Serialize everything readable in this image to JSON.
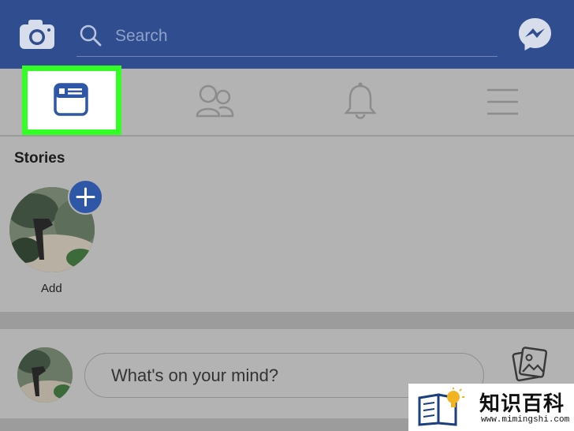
{
  "header": {
    "search_placeholder": "Search",
    "icons": [
      "camera-icon",
      "search-icon",
      "messenger-icon"
    ]
  },
  "tabs": [
    {
      "name": "news-feed",
      "icon": "news-feed-icon",
      "selected": true
    },
    {
      "name": "friends",
      "icon": "friends-icon",
      "selected": false
    },
    {
      "name": "notifications",
      "icon": "bell-icon",
      "selected": false
    },
    {
      "name": "menu",
      "icon": "menu-icon",
      "selected": false
    }
  ],
  "stories": {
    "title": "Stories",
    "add_label": "Add"
  },
  "composer": {
    "prompt": "What's on your mind?"
  },
  "watermark": {
    "title": "知识百科",
    "url": "www.mimingshi.com"
  },
  "colors": {
    "header_bg": "#2f4d8f",
    "highlight": "#33ff26",
    "accent": "#2f57a8"
  }
}
